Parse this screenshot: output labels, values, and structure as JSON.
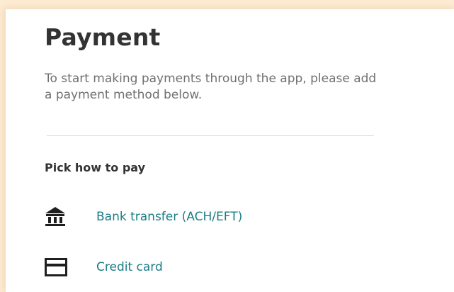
{
  "header": {
    "title": "Payment"
  },
  "intro": {
    "text": "To start making payments through the app, please add a payment method below."
  },
  "section": {
    "heading": "Pick how to pay"
  },
  "methods": [
    {
      "label": "Bank transfer (ACH/EFT)",
      "icon": "bank-icon"
    },
    {
      "label": "Credit card",
      "icon": "credit-card-icon"
    }
  ],
  "colors": {
    "background": "#fdebd3",
    "panel": "#ffffff",
    "heading": "#333333",
    "body_text": "#707070",
    "link": "#1a7d86",
    "icon": "#1f1f1f"
  }
}
